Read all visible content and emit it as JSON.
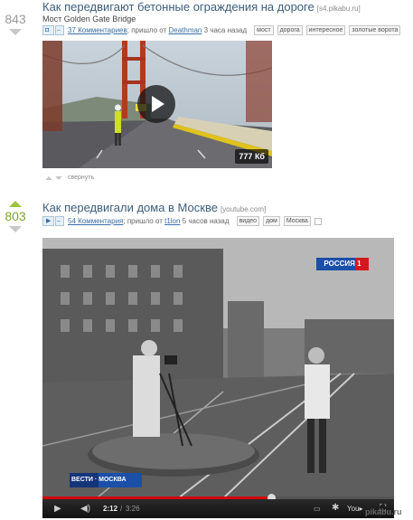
{
  "posts": [
    {
      "rating": "843",
      "title": "Как передвигают бетонные ограждения на дороге",
      "source": "[s4.pikabu.ru]",
      "subtitle": "Мост Golden Gate Bridge",
      "comments": "37 Комментариев",
      "came_from": "; пришло от",
      "author": "Deathman",
      "time": "3 часа назад",
      "tags": [
        "мост",
        "дорога",
        "интересное",
        "золотые ворота"
      ],
      "size": "777 Кб",
      "collapse": "свернуть"
    },
    {
      "rating": "803",
      "title": "Как передвигали дома в Москве",
      "source": "[youtube.com]",
      "comments": "54 Комментария",
      "came_from": "; пришло от",
      "author": "t1lon",
      "time": "5 часов назад",
      "tags": [
        "видео",
        "дом",
        "Москва"
      ],
      "channel_logo": "РОССИЯ 1",
      "corner_logo": "ВЕСТИ · МОСКВА",
      "time_current": "2:12",
      "time_total": "3:26",
      "progress": 0.65
    }
  ],
  "watermark": "pikabu.ru",
  "colors": {
    "upvote_active": "#9bc43c",
    "progress": "#d40000",
    "link": "#3a6ea5"
  },
  "icons": [
    "vote-up-icon",
    "vote-down-icon",
    "photo-icon",
    "video-icon",
    "minus-icon",
    "play-icon",
    "volume-icon",
    "gear-icon",
    "fullscreen-icon"
  ]
}
